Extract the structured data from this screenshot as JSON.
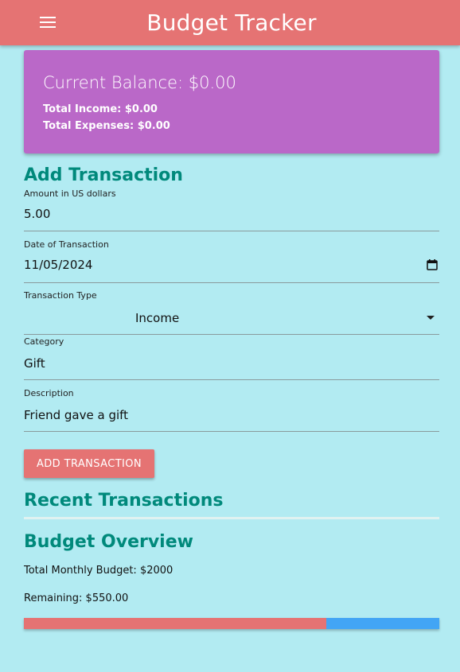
{
  "appbar": {
    "title": "Budget Tracker",
    "menu_icon": "hamburger-menu-icon"
  },
  "balance": {
    "current": "Current Balance: $0.00",
    "income": "Total Income: $0.00",
    "expenses": "Total Expenses: $0.00"
  },
  "form": {
    "heading": "Add Transaction",
    "amount": {
      "label": "Amount in US dollars",
      "value": "5.00"
    },
    "date": {
      "label": "Date of Transaction",
      "value": "11/05/2024",
      "icon": "calendar-icon"
    },
    "type": {
      "label": "Transaction Type",
      "value": "Income",
      "icon": "dropdown-caret-icon"
    },
    "category": {
      "label": "Category",
      "value": "Gift"
    },
    "description": {
      "label": "Description",
      "value": "Friend gave a gift"
    },
    "submit_label": "ADD TRANSACTION"
  },
  "recent": {
    "heading": "Recent Transactions"
  },
  "overview": {
    "heading": "Budget Overview",
    "total": "Total Monthly Budget: $2000",
    "remaining": "Remaining: $550.00",
    "spent_fraction": 0.7275
  },
  "colors": {
    "appbar": "#e57373",
    "card": "#ba68c8",
    "background": "#b2ebf2",
    "heading": "#00897b",
    "progress_spent": "#e57373",
    "progress_remaining": "#42a5f5"
  }
}
